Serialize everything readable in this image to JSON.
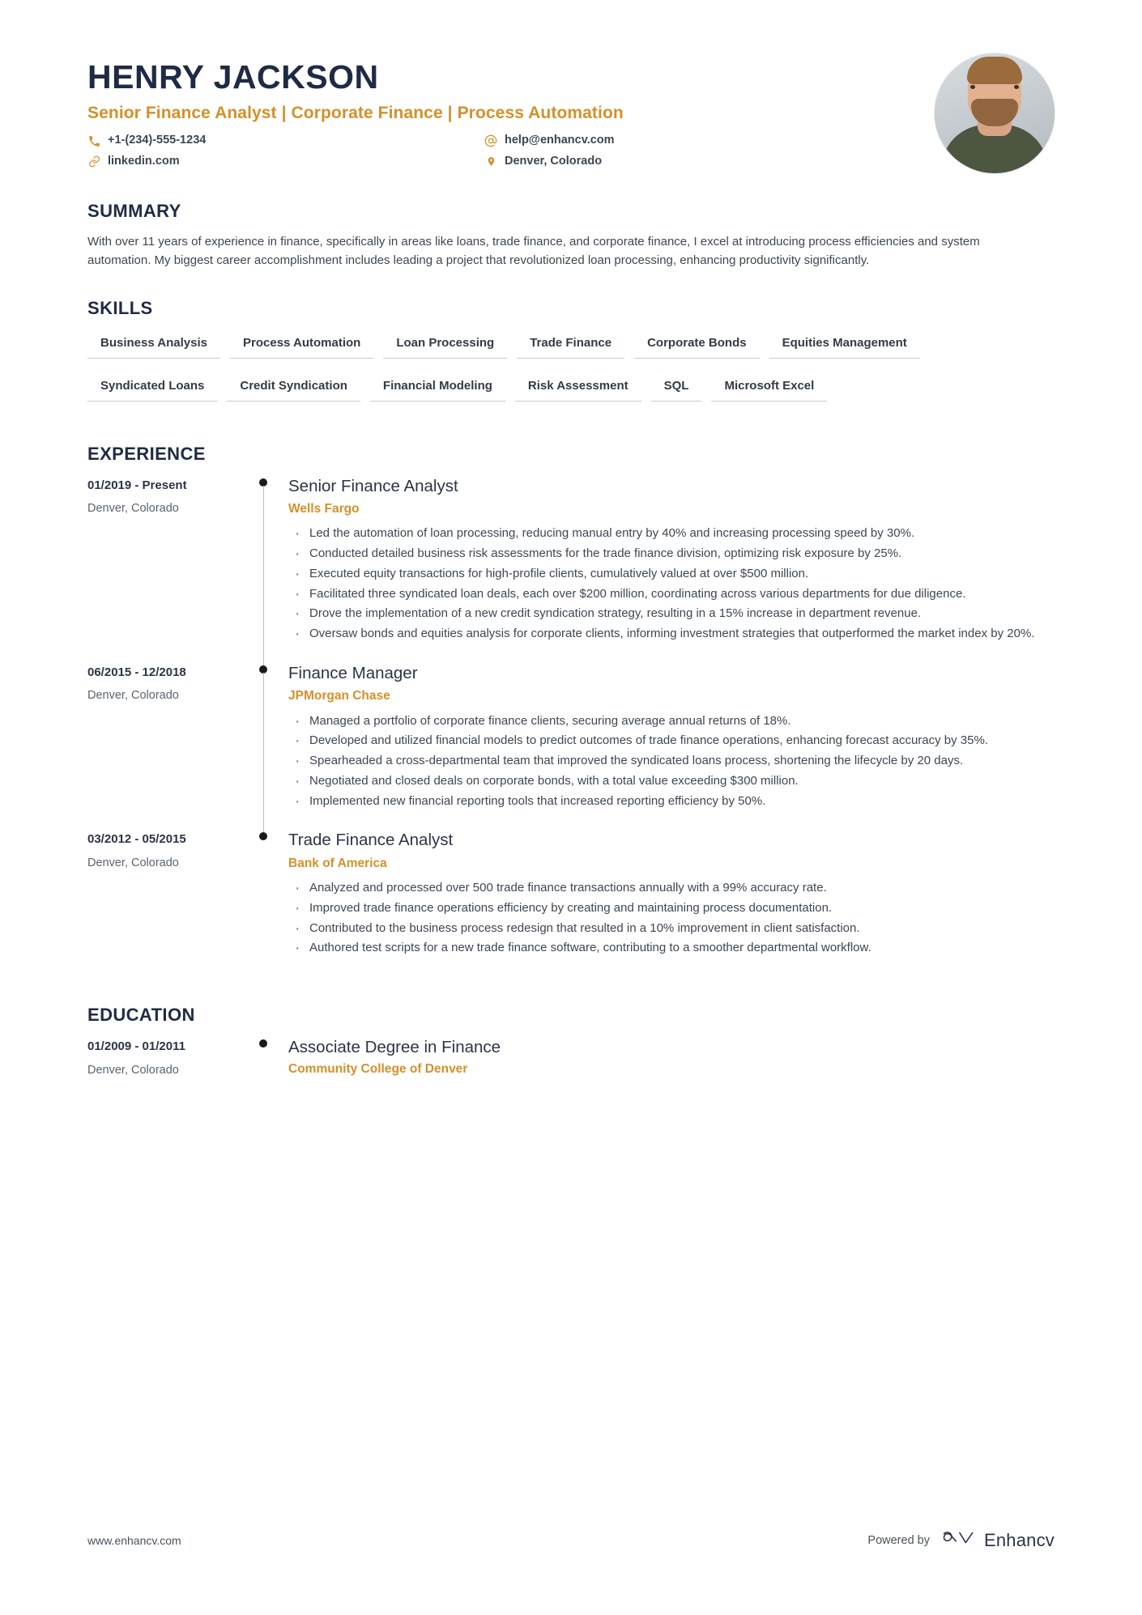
{
  "header": {
    "name": "HENRY JACKSON",
    "headline": "Senior Finance Analyst | Corporate Finance | Process Automation",
    "contacts": [
      {
        "icon": "phone-icon",
        "text": "+1-(234)-555-1234"
      },
      {
        "icon": "at-icon",
        "text": "help@enhancv.com"
      },
      {
        "icon": "link-icon",
        "text": "linkedin.com"
      },
      {
        "icon": "location-pin-icon",
        "text": "Denver, Colorado"
      }
    ],
    "photo_alt": "profile-photo"
  },
  "summary": {
    "title": "SUMMARY",
    "text": "With over 11 years of experience in finance, specifically in areas like loans, trade finance, and corporate finance, I excel at introducing process efficiencies and system automation. My biggest career accomplishment includes leading a project that revolutionized loan processing, enhancing productivity significantly."
  },
  "skills": {
    "title": "SKILLS",
    "items": [
      "Business Analysis",
      "Process Automation",
      "Loan Processing",
      "Trade Finance",
      "Corporate Bonds",
      "Equities Management",
      "Syndicated Loans",
      "Credit Syndication",
      "Financial Modeling",
      "Risk Assessment",
      "SQL",
      "Microsoft Excel"
    ]
  },
  "experience": {
    "title": "EXPERIENCE",
    "entries": [
      {
        "date": "01/2019 - Present",
        "location": "Denver, Colorado",
        "title": "Senior Finance Analyst",
        "company": "Wells Fargo",
        "bullets": [
          "Led the automation of loan processing, reducing manual entry by 40% and increasing processing speed by 30%.",
          "Conducted detailed business risk assessments for the trade finance division, optimizing risk exposure by 25%.",
          "Executed equity transactions for high-profile clients, cumulatively valued at over $500 million.",
          "Facilitated three syndicated loan deals, each over $200 million, coordinating across various departments for due diligence.",
          "Drove the implementation of a new credit syndication strategy, resulting in a 15% increase in department revenue.",
          "Oversaw bonds and equities analysis for corporate clients, informing investment strategies that outperformed the market index by 20%."
        ]
      },
      {
        "date": "06/2015 - 12/2018",
        "location": "Denver, Colorado",
        "title": "Finance Manager",
        "company": "JPMorgan Chase",
        "bullets": [
          "Managed a portfolio of corporate finance clients, securing average annual returns of 18%.",
          "Developed and utilized financial models to predict outcomes of trade finance operations, enhancing forecast accuracy by 35%.",
          "Spearheaded a cross-departmental team that improved the syndicated loans process, shortening the lifecycle by 20 days.",
          "Negotiated and closed deals on corporate bonds, with a total value exceeding $300 million.",
          "Implemented new financial reporting tools that increased reporting efficiency by 50%."
        ]
      },
      {
        "date": "03/2012 - 05/2015",
        "location": "Denver, Colorado",
        "title": "Trade Finance Analyst",
        "company": "Bank of America",
        "bullets": [
          "Analyzed and processed over 500 trade finance transactions annually with a 99% accuracy rate.",
          "Improved trade finance operations efficiency by creating and maintaining process documentation.",
          "Contributed to the business process redesign that resulted in a 10% improvement in client satisfaction.",
          "Authored test scripts for a new trade finance software, contributing to a smoother departmental workflow."
        ]
      }
    ]
  },
  "education": {
    "title": "EDUCATION",
    "entries": [
      {
        "date": "01/2009 - 01/2011",
        "location": "Denver, Colorado",
        "title": "Associate Degree in Finance",
        "company": "Community College of Denver"
      }
    ]
  },
  "footer": {
    "url": "www.enhancv.com",
    "powered_by": "Powered by",
    "brand": "Enhancv"
  },
  "colors": {
    "accent": "#d49029",
    "heading": "#1f2b45",
    "body": "#3d4652",
    "rule": "#c8ccd0"
  }
}
